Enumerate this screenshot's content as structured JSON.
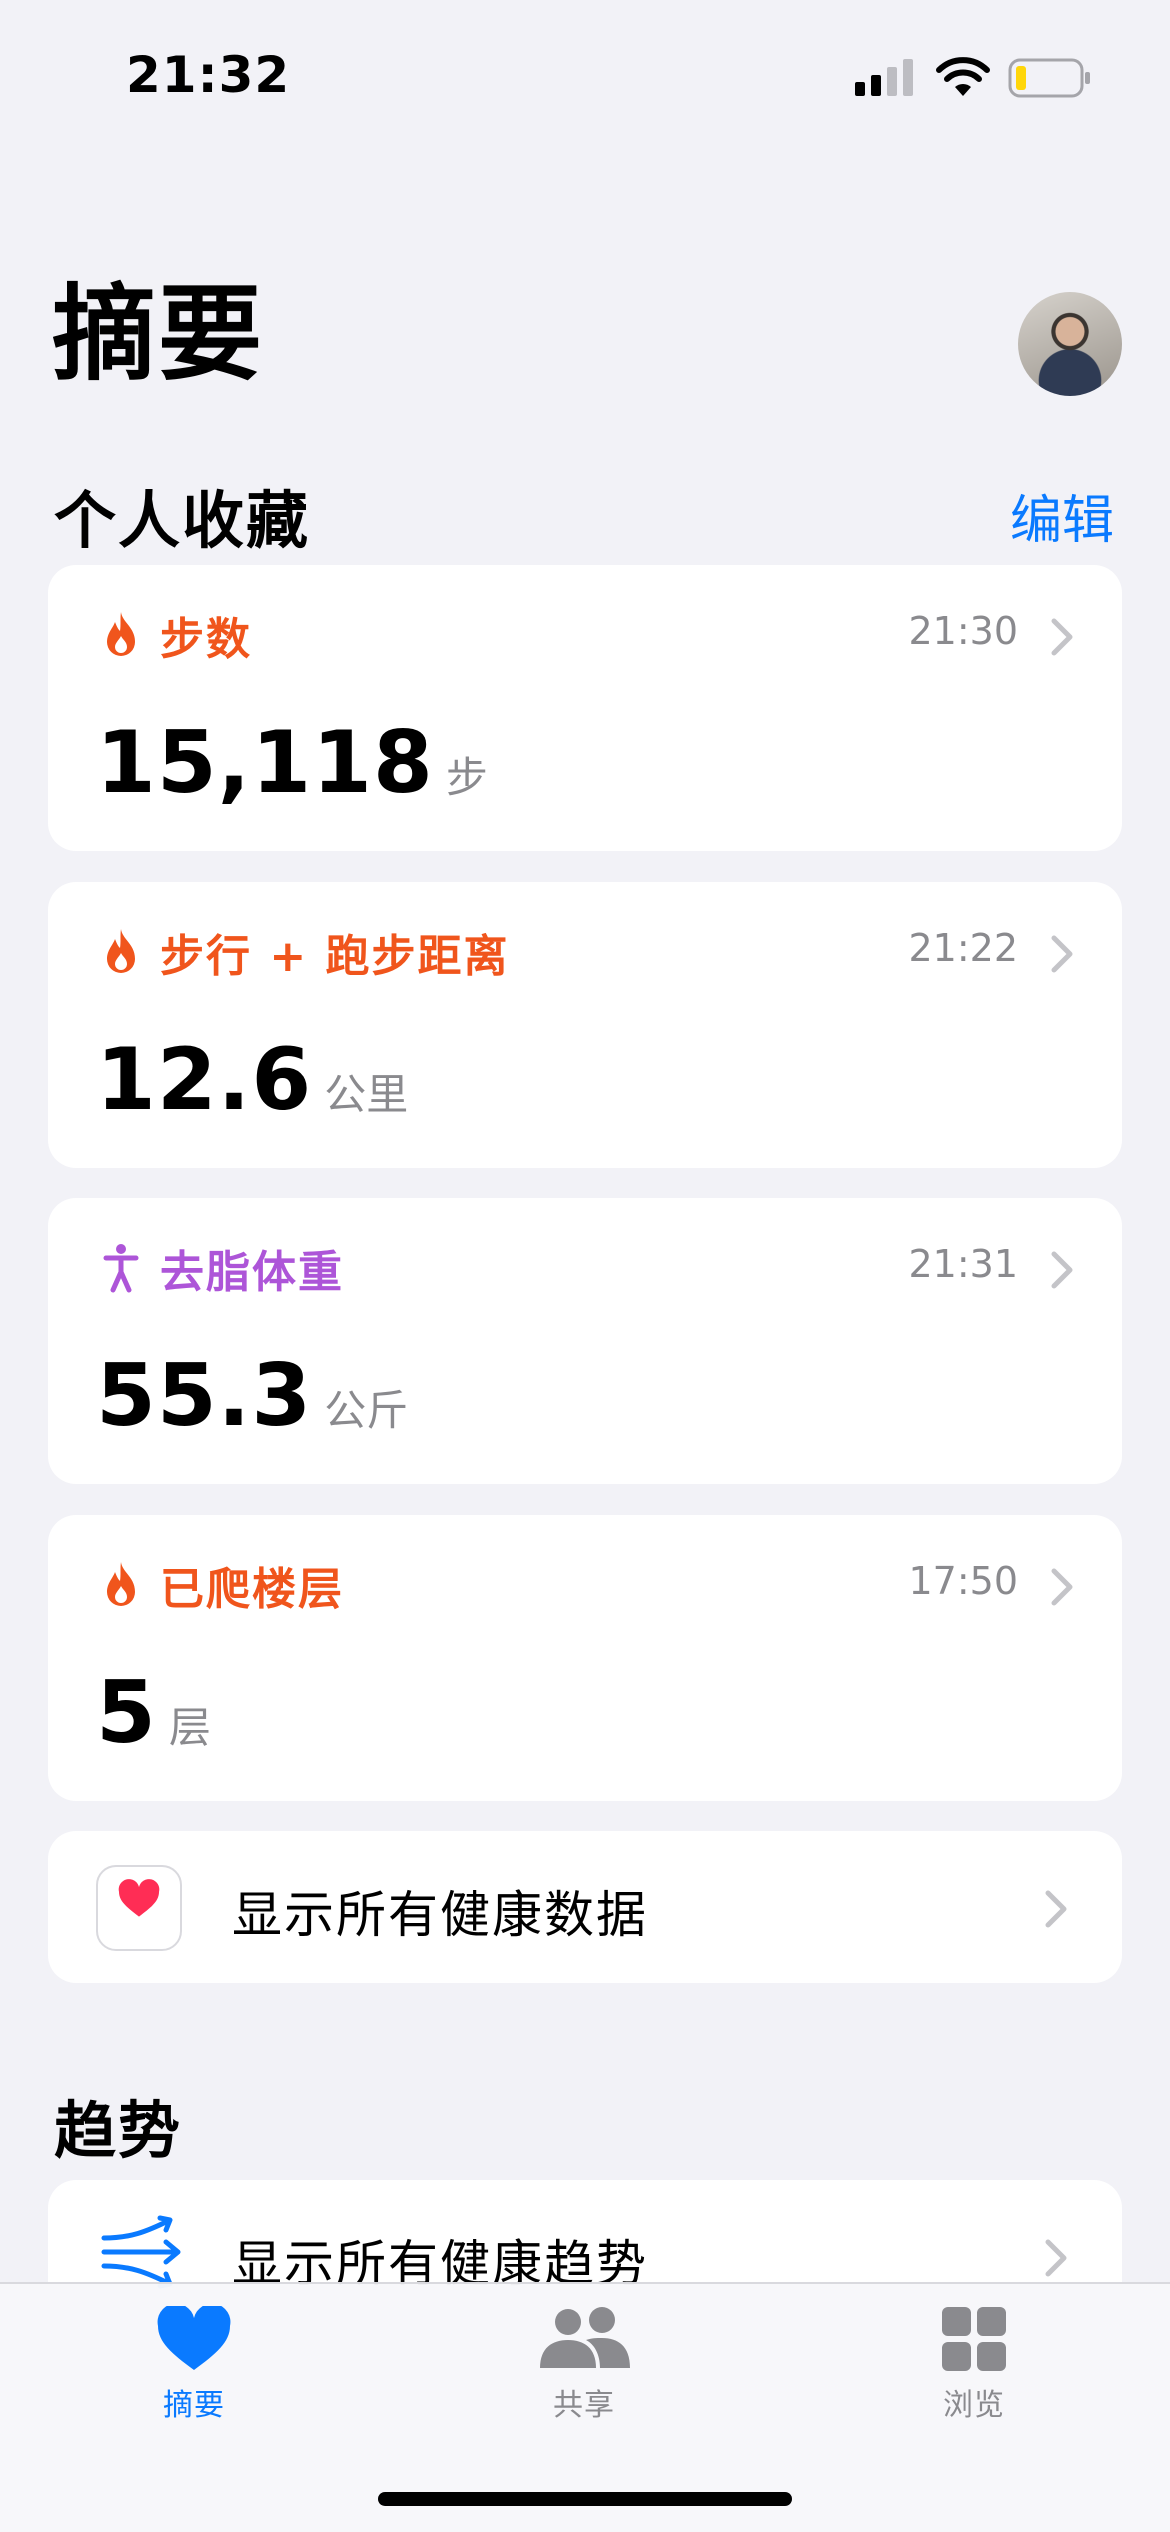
{
  "status_bar": {
    "time": "21:32"
  },
  "header": {
    "title": "摘要"
  },
  "favorites": {
    "title": "个人收藏",
    "edit_label": "编辑",
    "cards": [
      {
        "label": "步数",
        "time": "21:30",
        "value": "15,118",
        "unit": "步",
        "icon": "flame-icon",
        "color": "#f0551c"
      },
      {
        "label": "步行 + 跑步距离",
        "time": "21:22",
        "value": "12.6",
        "unit": "公里",
        "icon": "flame-icon",
        "color": "#f0551c"
      },
      {
        "label": "去脂体重",
        "time": "21:31",
        "value": "55.3",
        "unit": "公斤",
        "icon": "body-figure-icon",
        "color": "#ad55d8"
      },
      {
        "label": "已爬楼层",
        "time": "17:50",
        "value": "5",
        "unit": "层",
        "icon": "flame-icon",
        "color": "#f0551c"
      }
    ],
    "show_all_label": "显示所有健康数据"
  },
  "trends": {
    "title": "趋势",
    "show_all_label": "显示所有健康趋势"
  },
  "tab_bar": {
    "tabs": [
      {
        "label": "摘要",
        "icon": "heart-icon",
        "active": true
      },
      {
        "label": "共享",
        "icon": "people-icon",
        "active": false
      },
      {
        "label": "浏览",
        "icon": "grid-icon",
        "active": false
      }
    ]
  },
  "colors": {
    "accent": "#0a7aff",
    "activity": "#f0551c",
    "body": "#ad55d8",
    "background": "#f2f2f7"
  }
}
